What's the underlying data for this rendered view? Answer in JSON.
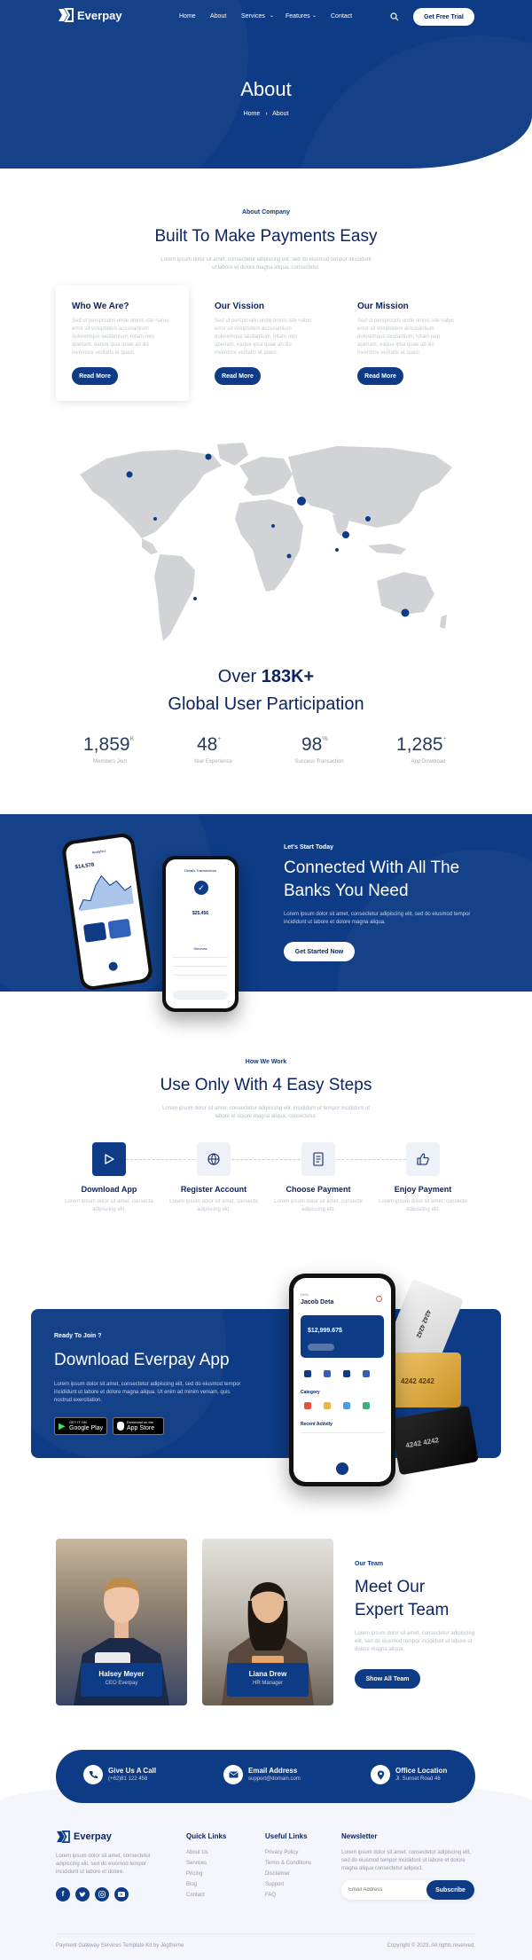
{
  "brand": {
    "name": "Everpay"
  },
  "nav": {
    "items": [
      "Home",
      "About",
      "Services",
      "Features",
      "Contact"
    ],
    "cta": "Get Free Trial"
  },
  "hero": {
    "title": "About",
    "crumb_home": "Home",
    "crumb_current": "About"
  },
  "about": {
    "eyebrow": "About Company",
    "title": "Built To Make Payments Easy",
    "text": "Lorem ipsum dolor sit amet, consectetur adipiscing elit, sed do eiusmod tempor incididunt ut labore et dolore magna aliqua, consectetur.",
    "cards": [
      {
        "title": "Who We Are?",
        "text": "Sed ut perspiciatis unde omnis iste natus error sit voluptatem accusantium doloremque laudantium, totam rem aperiam, eaque ipsa quae ab illo inventore veritatis et quasi.",
        "button": "Read More"
      },
      {
        "title": "Our Vission",
        "text": "Sed ut perspiciatis unde omnis iste natus error sit voluptatem accusantium doloremque laudantium, totam rem aperiam, eaque ipsa quae ab illo inventore veritatis et quasi.",
        "button": "Read More"
      },
      {
        "title": "Our Mission",
        "text": "Sed ut perspiciatis unde omnis iste natus error sit voluptatem accusantium doloremque laudantium, totam rem aperiam, eaque ipsa quae ab illo inventore veritatis et quasi.",
        "button": "Read More"
      }
    ]
  },
  "global": {
    "title_pre": "Over ",
    "title_bold": "183K+",
    "title_line2": "Global User Participation",
    "stats": [
      {
        "value": "1,859",
        "suffix": "K",
        "label": "Members Join"
      },
      {
        "value": "48",
        "suffix": "+",
        "label": "Year Experience"
      },
      {
        "value": "98",
        "suffix": "%",
        "label": "Success Transaction"
      },
      {
        "value": "1,285",
        "suffix": "+",
        "label": "App Download"
      }
    ]
  },
  "connect": {
    "eyebrow": "Let's Start Today",
    "title1": "Connected With All The",
    "title2": "Banks You Need",
    "text": "Lorem ipsum dolor sit amet, consectetur adipiscing elit, sed do eiusmod tempor incididunt ut labore et dolore magna aliqua.",
    "button": "Get Started Now",
    "phone_back": {
      "header": "Analytics",
      "amount": "$14,578"
    },
    "phone_front": {
      "title": "Details Transactions",
      "amount": "$25,456",
      "services": "Services"
    }
  },
  "steps": {
    "eyebrow": "How We Work",
    "title": "Use Only With 4 Easy Steps",
    "text": "Lorem ipsum dolor sit amet, consectetur adipiscing elit, incididunt ut tempor incididunt ut labore et dolore magna aliqua, consectetur.",
    "items": [
      {
        "title": "Download App",
        "text": "Lorem ipsum dolor sit amet, consecte adipiscing elit."
      },
      {
        "title": "Register Account",
        "text": "Lorem ipsum dolor sit amet, consecte adipiscing elit."
      },
      {
        "title": "Choose Payment",
        "text": "Lorem ipsum dolor sit amet, consecte adipiscing elit."
      },
      {
        "title": "Enjoy Payment",
        "text": "Lorem ipsum dolor sit amet, consecte adipiscing elit."
      }
    ]
  },
  "download": {
    "eyebrow": "Ready To Join ?",
    "title": "Download Everpay App",
    "text": "Lorem ipsum dolor sit amet, consectetur adipiscing elit, sed do eiusmod tempor incididunt ut labore et dolore magna aliqua. Ut enim ad minim veniam, quis nostrud exercitation.",
    "google_small": "GET IT ON",
    "google": "Google Play",
    "apple_small": "Download on the",
    "apple": "App Store",
    "phone": {
      "hello": "Hello,",
      "name": "Jacob Deta",
      "balance": "$12,999.67$",
      "category": "Category",
      "recent": "Recent Activity"
    },
    "card_number": "4242 4242"
  },
  "team": {
    "eyebrow": "Our Team",
    "title1": "Meet Our",
    "title2": "Expert Team",
    "text": "Lorem ipsum dolor sit amet, consectetur adipiscing elit, sed do eiusmod tempor incididunt ut labore et dolore magna aliqua.",
    "button": "Show All Team",
    "members": [
      {
        "name": "Halsey Meyer",
        "role": "CEO Everpay"
      },
      {
        "name": "Liana Drew",
        "role": "HR Manager"
      }
    ]
  },
  "contact": {
    "items": [
      {
        "title": "Give Us A Call",
        "value": "(+62)81 122 458"
      },
      {
        "title": "Email Address",
        "value": "support@domain.com"
      },
      {
        "title": "Office Location",
        "value": "Jl. Sunset Road 46"
      }
    ]
  },
  "footer": {
    "about": "Lorem ipsum dolor sit amet, consectetur adipiscing elit, sed do eiusmod tempor incididunt ut labore et dolore.",
    "quick_title": "Quick Links",
    "quick": [
      "About Us",
      "Services",
      "Pricing",
      "Blog",
      "Contact"
    ],
    "useful_title": "Useful Links",
    "useful": [
      "Privacy Policy",
      "Terms & Conditions",
      "Disclaimer",
      "Support",
      "FAQ"
    ],
    "news_title": "Newsletter",
    "news_text": "Lorem ipsum dolor sit amet, consectetur adipiscing elit, sed do eiusmod tempor incididunt ut labore et dolore magna aliqua consectetur adipiscl.",
    "email_placeholder": "Email Address",
    "subscribe": "Subscribe",
    "bottom_left": "Payment Gateway Services Template Kit by Jegtheme",
    "bottom_right": "Copyright © 2023. All rights reserved."
  },
  "colors": {
    "primary": "#0d3b85",
    "dark_text": "#0d2461",
    "muted": "#9aa4b8"
  }
}
